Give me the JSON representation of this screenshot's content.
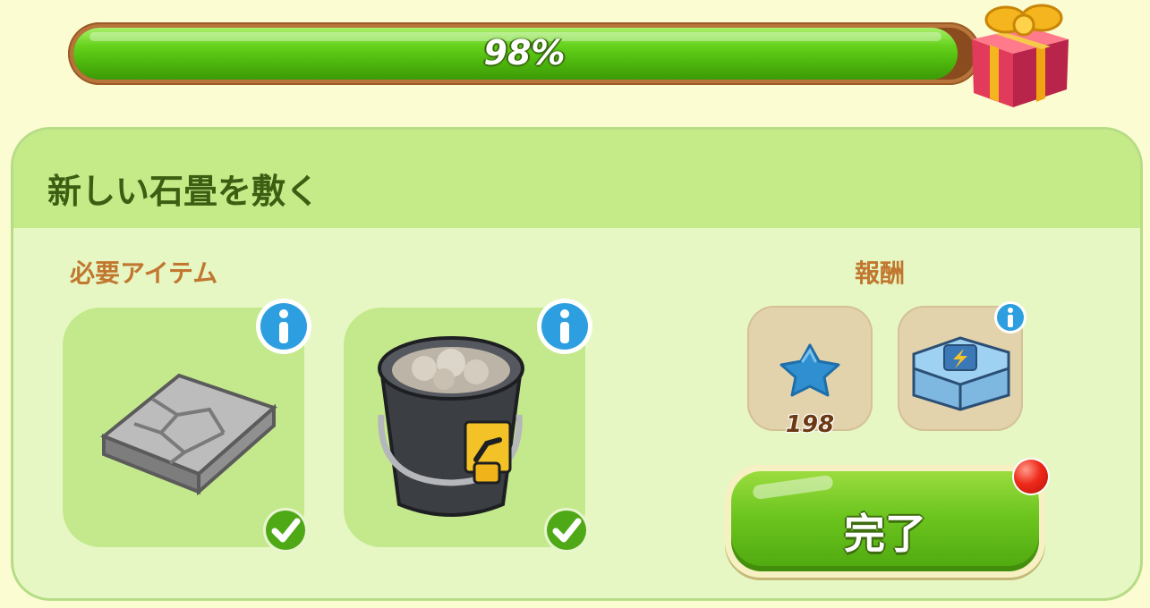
{
  "progress": {
    "label": "98%",
    "value_percent": 98,
    "reward_icon": "gift-box-icon"
  },
  "task": {
    "title": "新しい石畳を敷く"
  },
  "required": {
    "heading": "必要アイテム",
    "items": [
      {
        "name": "stone-slab",
        "icon": "stone-slab-icon",
        "fulfilled": true
      },
      {
        "name": "mortar-bucket",
        "icon": "mortar-bucket-icon",
        "fulfilled": true
      }
    ]
  },
  "rewards": {
    "heading": "報酬",
    "items": [
      {
        "icon": "blue-star-icon",
        "count": "198"
      },
      {
        "icon": "energy-chest-icon",
        "count": ""
      }
    ]
  },
  "actions": {
    "complete_label": "完了"
  },
  "colors": {
    "accent_green": "#5cc317",
    "title_green": "#3b5e12",
    "label_orange": "#c1772f",
    "info_blue": "#2d9fe0"
  }
}
